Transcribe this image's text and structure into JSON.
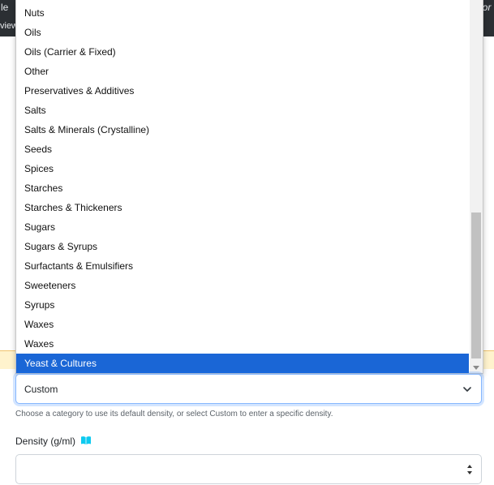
{
  "background": {
    "top_left_fragment": "le",
    "top_right_fragment": "dor",
    "nav_fragment": "view"
  },
  "dropdown": {
    "options": [
      "Nuts",
      "Oils",
      "Oils (Carrier & Fixed)",
      "Other",
      "Preservatives & Additives",
      "Salts",
      "Salts & Minerals (Crystalline)",
      "Seeds",
      "Spices",
      "Starches",
      "Starches & Thickeners",
      "Sugars",
      "Sugars & Syrups",
      "Surfactants & Emulsifiers",
      "Sweeteners",
      "Syrups",
      "Waxes",
      "Waxes",
      "Yeast & Cultures"
    ],
    "highlighted": "Yeast & Cultures",
    "scroll_position": 0.57
  },
  "category_select": {
    "value": "Custom",
    "help_text": "Choose a category to use its default density, or select Custom to enter a specific density."
  },
  "density": {
    "label": "Density (g/ml)",
    "value": ""
  },
  "colors": {
    "highlight": "#1a66d6",
    "focus_border": "#86b7fe",
    "book_icon": "#0dcaf0"
  }
}
